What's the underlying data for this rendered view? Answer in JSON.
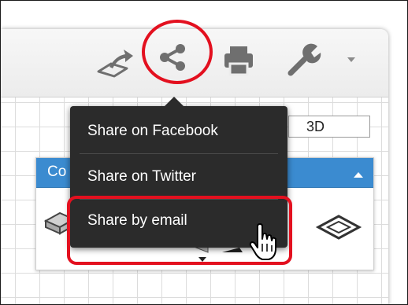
{
  "toolbar": {
    "icons": [
      "export-icon",
      "share-icon",
      "print-icon",
      "wrench-icon",
      "dropdown-arrow-icon"
    ]
  },
  "view_selector": {
    "value": "3D"
  },
  "widget": {
    "title_fragment": "Co"
  },
  "share_menu": {
    "items": [
      {
        "label": "Share on Facebook"
      },
      {
        "label": "Share on Twitter"
      },
      {
        "label": "Share by email"
      }
    ]
  },
  "colors": {
    "annotation_red": "#e3101f",
    "menu_background": "#2b2b2b",
    "widget_header_blue": "#3b8bd0",
    "icon_gray": "#6f6f6f"
  }
}
